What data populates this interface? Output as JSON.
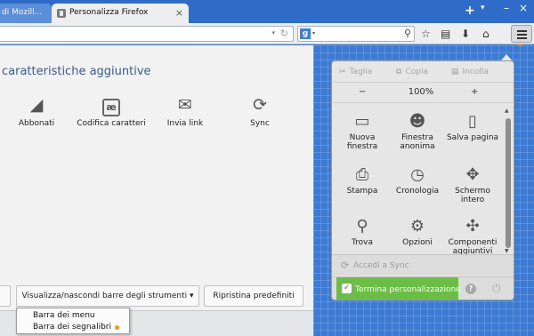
{
  "tabs": [
    {
      "label": "di Mozill..."
    },
    {
      "label": "Personalizza Firefox",
      "close": "×"
    }
  ],
  "window": {
    "new_tab": "+",
    "tab_menu": "▾",
    "minimize": "–",
    "close": "×"
  },
  "search": {
    "engine": "g",
    "engine_dropdown": "▾"
  },
  "urlbar": {
    "dropdown": "▾",
    "reload": "↻"
  },
  "content": {
    "title": "caratteristiche aggiuntive",
    "palette": [
      {
        "label": "Abbonati",
        "icon": "rss-icon",
        "glyph": "◢"
      },
      {
        "label": "Codifica caratteri",
        "icon": "character-encoding-icon",
        "glyph": "æ"
      },
      {
        "label": "Invia link",
        "icon": "email-link-icon",
        "glyph": "✉"
      },
      {
        "label": "Sync",
        "icon": "sync-icon",
        "glyph": "⟳"
      }
    ]
  },
  "bottom_buttons": {
    "toolbars": "Visualizza/nascondi barre degli strumenti ▾",
    "restore": "Ripristina predefiniti"
  },
  "toolbar_popup": [
    {
      "label": "Barra dei menu"
    },
    {
      "label": "Barra dei segnalibri"
    }
  ],
  "menu_panel": {
    "edit": {
      "cut": "Taglia",
      "copy": "Copia",
      "paste": "Incolla"
    },
    "zoom": {
      "out": "−",
      "level": "100%",
      "in": "+"
    },
    "items": [
      {
        "label": "Nuova finestra",
        "icon": "new-window-icon",
        "glyph": "▭"
      },
      {
        "label": "Finestra anonima",
        "icon": "private-window-icon",
        "glyph": "☻"
      },
      {
        "label": "Salva pagina",
        "icon": "save-page-icon",
        "glyph": "▯"
      },
      {
        "label": "Stampa",
        "icon": "print-icon",
        "glyph": "⎙"
      },
      {
        "label": "Cronologia",
        "icon": "history-icon",
        "glyph": "◷"
      },
      {
        "label": "Schermo intero",
        "icon": "fullscreen-icon",
        "glyph": "✥"
      },
      {
        "label": "Trova",
        "icon": "find-icon",
        "glyph": "⚲"
      },
      {
        "label": "Opzioni",
        "icon": "options-icon",
        "glyph": "⚙"
      },
      {
        "label": "Componenti aggiuntivi",
        "icon": "addons-icon",
        "glyph": "✣"
      }
    ],
    "sync_label": "Accedi a Sync",
    "exit_customize": "Termina personalizzazione",
    "help": "?",
    "quit": "⏻"
  },
  "colors": {
    "customize_background": "#3b7bd6",
    "exit_button": "#6bbd46",
    "notification_dot": "#f19a1e"
  }
}
